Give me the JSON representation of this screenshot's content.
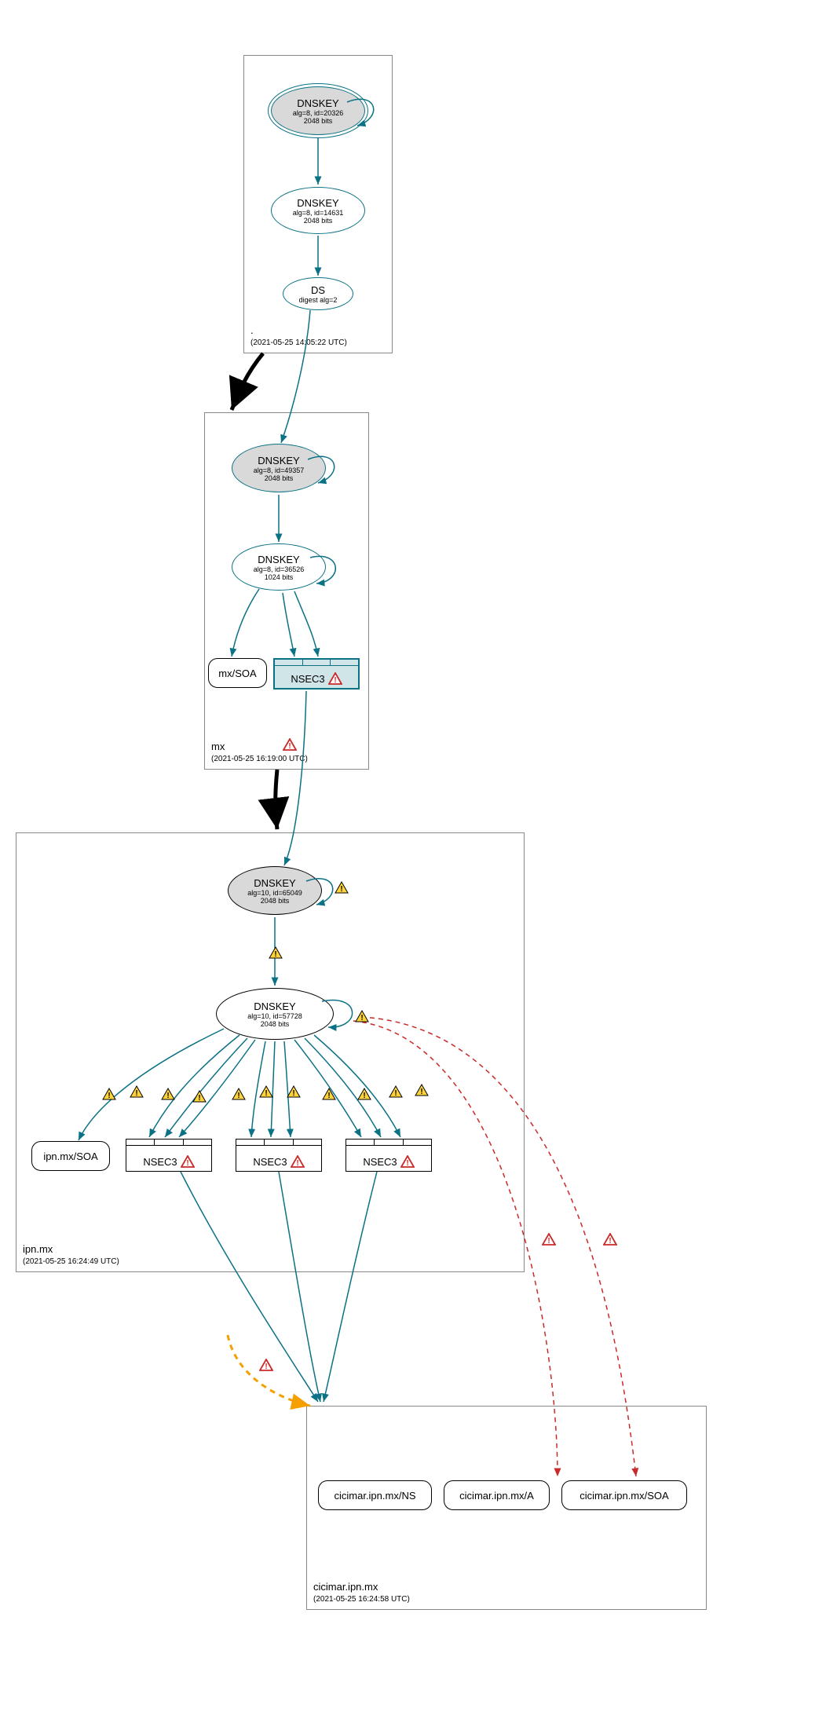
{
  "zones": {
    "root": {
      "name": ".",
      "ts": "(2021-05-25 14:05:22 UTC)"
    },
    "mx": {
      "name": "mx",
      "ts": "(2021-05-25 16:19:00 UTC)"
    },
    "ipn": {
      "name": "ipn.mx",
      "ts": "(2021-05-25 16:24:49 UTC)"
    },
    "cicimar": {
      "name": "cicimar.ipn.mx",
      "ts": "(2021-05-25 16:24:58 UTC)"
    }
  },
  "nodes": {
    "root_ksk": {
      "l1": "DNSKEY",
      "l2": "alg=8, id=20326",
      "l3": "2048 bits"
    },
    "root_zsk": {
      "l1": "DNSKEY",
      "l2": "alg=8, id=14631",
      "l3": "2048 bits"
    },
    "ds": {
      "l1": "DS",
      "l2": "digest alg=2"
    },
    "mx_ksk": {
      "l1": "DNSKEY",
      "l2": "alg=8, id=49357",
      "l3": "2048 bits"
    },
    "mx_zsk": {
      "l1": "DNSKEY",
      "l2": "alg=8, id=36526",
      "l3": "1024 bits"
    },
    "mx_soa": "mx/SOA",
    "nsec3": "NSEC3",
    "ipn_ksk": {
      "l1": "DNSKEY",
      "l2": "alg=10, id=65049",
      "l3": "2048 bits"
    },
    "ipn_zsk": {
      "l1": "DNSKEY",
      "l2": "alg=10, id=57728",
      "l3": "2048 bits"
    },
    "ipn_soa": "ipn.mx/SOA",
    "cic_ns": "cicimar.ipn.mx/NS",
    "cic_a": "cicimar.ipn.mx/A",
    "cic_soa": "cicimar.ipn.mx/SOA"
  }
}
